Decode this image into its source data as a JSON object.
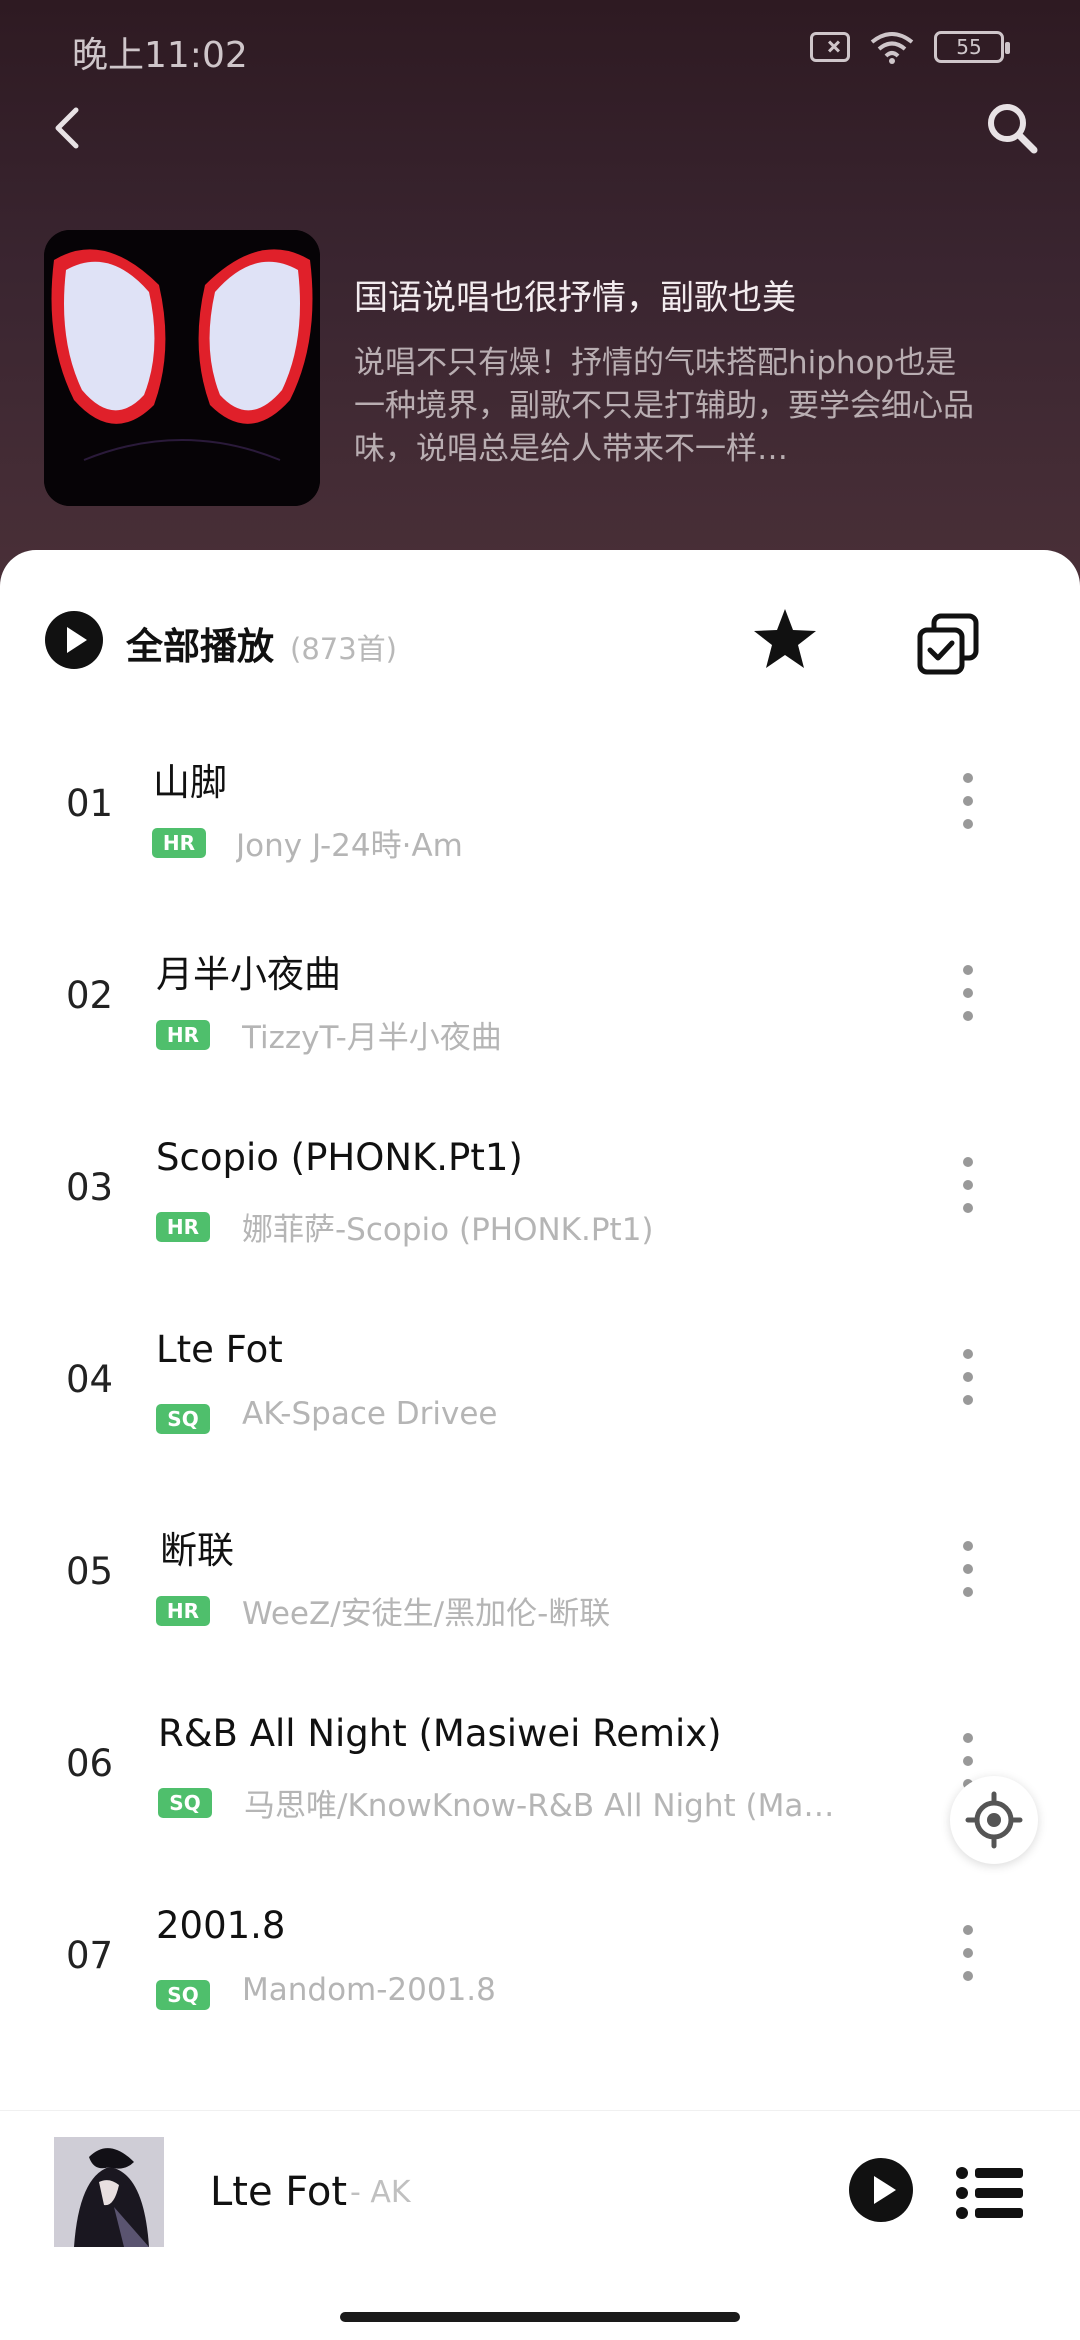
{
  "status": {
    "time": "晚上11:02",
    "battery": "55"
  },
  "playlist": {
    "title": "国语说唱也很抒情，副歌也美",
    "description": "说唱不只有燥！抒情的气味搭配hiphop也是一种境界，副歌不只是打辅助，要学会细心品味，说唱总是给人带来不一样…"
  },
  "toolbar": {
    "play_all_label": "全部播放",
    "count": "(873首)"
  },
  "songs": [
    {
      "num": "01",
      "title": "山脚",
      "badge": "HR",
      "artist": "Jony J-24時·Am"
    },
    {
      "num": "02",
      "title": "月半小夜曲",
      "badge": "HR",
      "artist": "TizzyT-月半小夜曲"
    },
    {
      "num": "03",
      "title": "Scopio (PHONK.Pt1)",
      "badge": "HR",
      "artist": "娜菲萨-Scopio (PHONK.Pt1)"
    },
    {
      "num": "04",
      "title": "Lte Fot",
      "badge": "SQ",
      "artist": "AK-Space Drivee"
    },
    {
      "num": "05",
      "title": "断联",
      "badge": "HR",
      "artist": "WeeZ/安徒生/黑加伦-断联"
    },
    {
      "num": "06",
      "title": "R&B All Night (Masiwei Remix)",
      "badge": "SQ",
      "artist": "马思唯/KnowKnow-R&B All Night (Ma…"
    },
    {
      "num": "07",
      "title": "2001.8",
      "badge": "SQ",
      "artist": "Mandom-2001.8"
    }
  ],
  "now_playing": {
    "title": "Lte Fot",
    "artist": "- AK"
  },
  "colors": {
    "badge_green": "#4fbf6c",
    "header_bg": "#3a2530",
    "spider_red": "#e0202a"
  },
  "icons": [
    "back-arrow-icon",
    "search-icon",
    "play-circle-icon",
    "star-icon",
    "multi-select-icon",
    "more-vertical-icon",
    "locate-icon",
    "queue-list-icon"
  ]
}
